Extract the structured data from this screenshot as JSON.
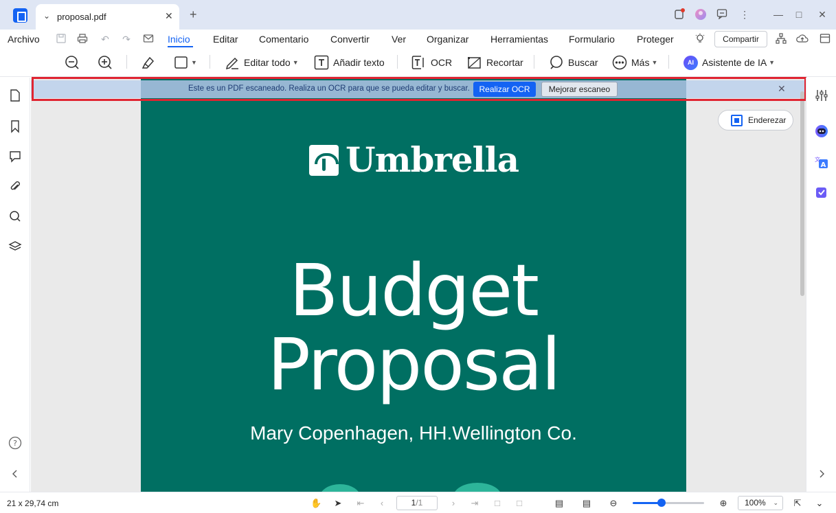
{
  "tab": {
    "title": "proposal.pdf"
  },
  "menu": {
    "archivo": "Archivo",
    "items": [
      "Inicio",
      "Editar",
      "Comentario",
      "Convertir",
      "Ver",
      "Organizar",
      "Herramientas",
      "Formulario",
      "Proteger"
    ],
    "active": "Inicio",
    "share": "Compartir"
  },
  "toolbar": {
    "edit_all": "Editar todo",
    "add_text": "Añadir texto",
    "ocr": "OCR",
    "crop": "Recortar",
    "search": "Buscar",
    "more": "Más",
    "ai_badge": "AI",
    "ai": "Asistente de IA"
  },
  "notice": {
    "text": "Este es un PDF escaneado. Realiza un OCR para que se pueda editar y buscar.",
    "ocr_button": "Realizar OCR",
    "enhance_button": "Mejorar escaneo"
  },
  "straighten": "Enderezar",
  "document": {
    "brand": "Umbrella",
    "title_line1": "Budget",
    "title_line2": "Proposal",
    "author": "Mary Copenhagen, HH.Wellington Co."
  },
  "status": {
    "page_size": "21 x 29,74 cm",
    "current_page": "1",
    "total_pages": "/1",
    "zoom": "100%",
    "zoom_fraction": 0.4
  },
  "colors": {
    "accent": "#1463f3",
    "page_bg": "#006f62",
    "highlight_outline": "#e02431"
  }
}
